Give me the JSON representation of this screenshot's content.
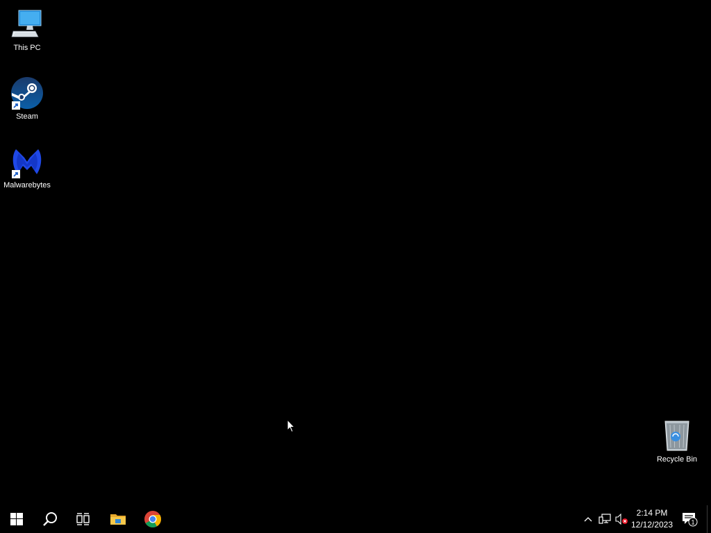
{
  "desktop": {
    "background_color": "#000000",
    "icons": [
      {
        "label": "This PC",
        "icon": "this-pc-icon"
      },
      {
        "label": "Steam",
        "icon": "steam-icon"
      },
      {
        "label": "Malwarebytes",
        "icon": "malwarebytes-icon"
      },
      {
        "label": "Recycle Bin",
        "icon": "recycle-bin-icon"
      }
    ]
  },
  "taskbar": {
    "background_color": "#000000",
    "pinned": [
      {
        "icon": "windows-start-icon"
      },
      {
        "icon": "search-icon"
      },
      {
        "icon": "task-view-icon"
      },
      {
        "icon": "file-explorer-icon"
      },
      {
        "icon": "chrome-icon"
      }
    ],
    "tray": {
      "icons": [
        "chevron-up-icon",
        "network-icon",
        "volume-muted-icon"
      ],
      "clock": {
        "time": "2:14 PM",
        "date": "12/12/2023"
      },
      "notifications": {
        "icon": "notification-icon",
        "count": "1"
      }
    }
  }
}
